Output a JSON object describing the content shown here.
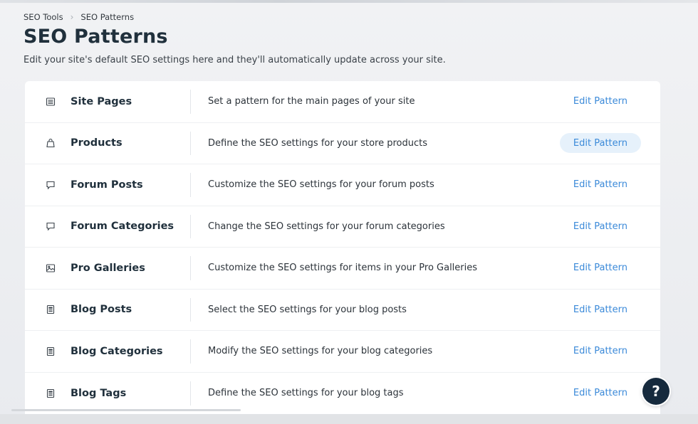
{
  "breadcrumb": {
    "root": "SEO Tools",
    "separator": "›",
    "current": "SEO Patterns"
  },
  "header": {
    "title": "SEO Patterns",
    "subtitle": "Edit your site's default SEO settings here and they'll automatically update across your site."
  },
  "patterns": [
    {
      "icon": "page-icon",
      "name": "Site Pages",
      "description": "Set a pattern for the main pages of your site",
      "action": "Edit Pattern"
    },
    {
      "icon": "bag-icon",
      "name": "Products",
      "description": "Define the SEO settings for your store products",
      "action": "Edit Pattern"
    },
    {
      "icon": "chat-icon",
      "name": "Forum Posts",
      "description": "Customize the SEO settings for your forum posts",
      "action": "Edit Pattern"
    },
    {
      "icon": "chat-icon",
      "name": "Forum Categories",
      "description": "Change the SEO settings for your forum categories",
      "action": "Edit Pattern"
    },
    {
      "icon": "image-icon",
      "name": "Pro Galleries",
      "description": "Customize the SEO settings for items in your Pro Galleries",
      "action": "Edit Pattern"
    },
    {
      "icon": "document-icon",
      "name": "Blog Posts",
      "description": "Select the SEO settings for your blog posts",
      "action": "Edit Pattern"
    },
    {
      "icon": "document-icon",
      "name": "Blog Categories",
      "description": "Modify the SEO settings for your blog categories",
      "action": "Edit Pattern"
    },
    {
      "icon": "document-icon",
      "name": "Blog Tags",
      "description": "Define the SEO settings for your blog tags",
      "action": "Edit Pattern"
    }
  ],
  "help": {
    "label": "?"
  },
  "colors": {
    "accent": "#3b8ad9",
    "hover_bg": "#e6f1fb",
    "help_bg": "#162a3d",
    "title": "#20303c"
  }
}
